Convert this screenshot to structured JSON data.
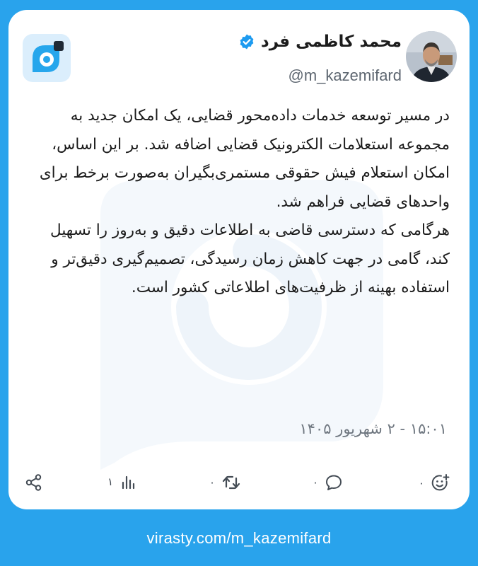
{
  "author": {
    "display_name": "محمد کاظمی فرد",
    "handle": "@m_kazemifard",
    "verified": true
  },
  "post": {
    "paragraphs": [
      "در مسیر توسعه خدمات داده‌محور قضایی، یک امکان جدید به مجموعه استعلامات الکترونیک قضایی اضافه شد. بر این اساس، امکان استعلام فیش حقوقی مستمری‌بگیران به‌صورت برخط برای واحدهای قضایی فراهم شد.",
      "هرگامی که دسترسی قاضی به اطلاعات دقیق و به‌روز را تسهیل کند، گامی در جهت کاهش زمان رسیدگی، تصمیم‌گیری دقیق‌تر و استفاده بهینه از ظرفیت‌های اطلاعاتی کشور است."
    ],
    "timestamp": "۱۵:۰۱ - ۲ شهریور ۱۴۰۵"
  },
  "actions": {
    "react_count": "۰",
    "reply_count": "۰",
    "repost_count": "۰",
    "views_count": "۱"
  },
  "footer": {
    "url": "virasty.com/m_kazemifard"
  },
  "colors": {
    "background": "#29a3ec",
    "card": "#ffffff",
    "verified": "#1d9bf0",
    "text": "#1b1b1b",
    "muted": "#6f7780"
  }
}
